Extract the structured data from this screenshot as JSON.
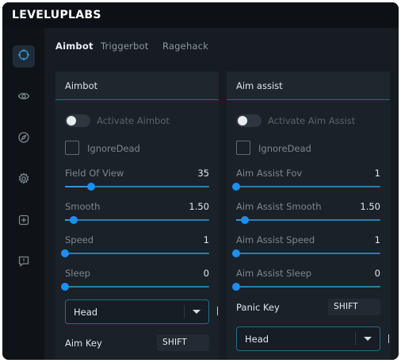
{
  "app": {
    "title": "LEVELUPLABS"
  },
  "sidebar": {
    "items": [
      {
        "icon": "crosshair-icon",
        "active": true
      },
      {
        "icon": "eye-icon",
        "active": false
      },
      {
        "icon": "compass-icon",
        "active": false
      },
      {
        "icon": "gear-icon",
        "active": false
      },
      {
        "icon": "plus-square-icon",
        "active": false
      },
      {
        "icon": "message-alert-icon",
        "active": false
      }
    ]
  },
  "tabs": [
    {
      "label": "Aimbot",
      "active": true
    },
    {
      "label": "Triggerbot",
      "active": false
    },
    {
      "label": "Ragehack",
      "active": false
    }
  ],
  "panels": {
    "aimbot": {
      "title": "Aimbot",
      "toggle_label": "Activate Aimbot",
      "toggle_on": false,
      "checkbox_label": "IgnoreDead",
      "checkbox_checked": false,
      "sliders": [
        {
          "label": "Field Of View",
          "value": "35",
          "fraction": 0.18
        },
        {
          "label": "Smooth",
          "value": "1.50",
          "fraction": 0.06
        },
        {
          "label": "Speed",
          "value": "1",
          "fraction": 0.0
        },
        {
          "label": "Sleep",
          "value": "0",
          "fraction": 0.0
        }
      ],
      "select_value": "Head",
      "key_label": "Aim Key",
      "key_value": "SHIFT"
    },
    "assist": {
      "title": "Aim assist",
      "toggle_label": "Activate Aim Assist",
      "toggle_on": false,
      "checkbox_label": "IgnoreDead",
      "checkbox_checked": false,
      "sliders": [
        {
          "label": "Aim Assist Fov",
          "value": "1",
          "fraction": 0.0
        },
        {
          "label": "Aim Assist Smooth",
          "value": "1.50",
          "fraction": 0.06
        },
        {
          "label": "Aim Assist Speed",
          "value": "1",
          "fraction": 0.0
        },
        {
          "label": "Aim Assist Sleep",
          "value": "0",
          "fraction": 0.0
        }
      ],
      "key_label": "Panic Key",
      "key_value": "SHIFT",
      "select_value": "Head"
    }
  },
  "colors": {
    "accent": "#1e8ef0",
    "border": "#1f6f8c",
    "background": "#13181d"
  }
}
